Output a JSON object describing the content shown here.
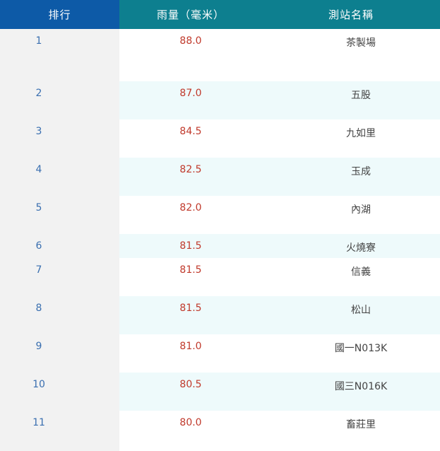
{
  "header": {
    "rank": "排行",
    "rainfall": "雨量（毫米）",
    "station": "測站名稱"
  },
  "rows": [
    {
      "rank": "1",
      "rainfall": "88.0",
      "station": "茶製場"
    },
    {
      "rank": "2",
      "rainfall": "87.0",
      "station": "五股"
    },
    {
      "rank": "3",
      "rainfall": "84.5",
      "station": "九如里"
    },
    {
      "rank": "4",
      "rainfall": "82.5",
      "station": "玉成"
    },
    {
      "rank": "5",
      "rainfall": "82.0",
      "station": "內湖"
    },
    {
      "rank": "6",
      "rainfall": "81.5",
      "station": "火燒寮"
    },
    {
      "rank": "7",
      "rainfall": "81.5",
      "station": "信義"
    },
    {
      "rank": "8",
      "rainfall": "81.5",
      "station": "松山"
    },
    {
      "rank": "9",
      "rainfall": "81.0",
      "station": "國一N013K"
    },
    {
      "rank": "10",
      "rainfall": "80.5",
      "station": "國三N016K"
    },
    {
      "rank": "11",
      "rainfall": "80.0",
      "station": "畜莊里"
    }
  ],
  "colors": {
    "rank_header": "#0d5aa7",
    "header": "#0d7f8f",
    "rank_text": "#3a6fb0",
    "rainfall_text": "#c0392b"
  }
}
